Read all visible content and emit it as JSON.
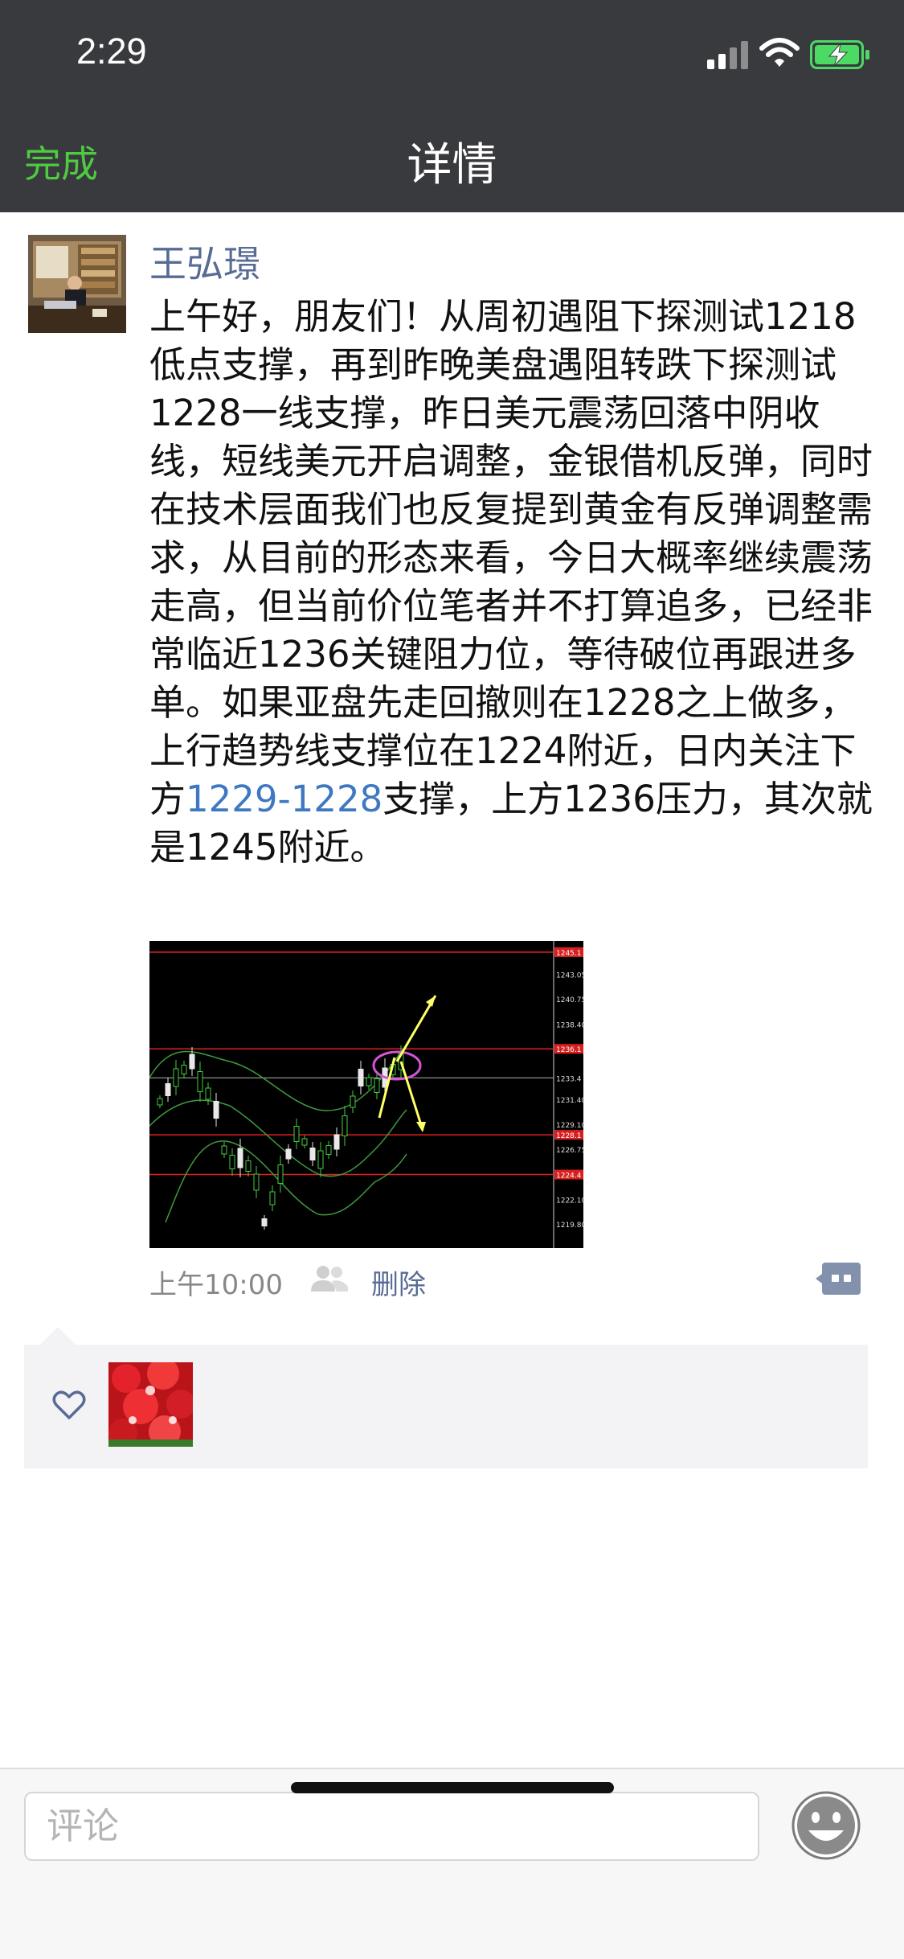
{
  "status_bar": {
    "time": "2:29",
    "icons": [
      "signal-icon",
      "wifi-icon",
      "battery-charging-icon"
    ],
    "battery_color": "#4cd964"
  },
  "nav": {
    "done_label": "完成",
    "title": "详情",
    "done_color": "#4fcb41"
  },
  "post": {
    "author": "王弘璟",
    "text_before_link": "上午好，朋友们！从周初遇阻下探测试1218低点支撑，再到昨晚美盘遇阻转跌下探测试1228一线支撑，昨日美元震荡回落中阴收线，短线美元开启调整，金银借机反弹，同时在技术层面我们也反复提到黄金有反弹调整需求，从目前的形态来看，今日大概率继续震荡走高，但当前价位笔者并不打算追多，已经非常临近1236关键阻力位，等待破位再跟进多单。如果亚盘先走回撤则在1228之上做多，上行趋势线支撑位在1224附近，日内关注下方",
    "link_text": "1229-1228",
    "text_after_link": "支撑，上方1236压力，其次就是1245附近。",
    "time": "上午10:00",
    "delete_label": "删除",
    "author_color": "#576b95",
    "link_color": "#3f78c2"
  },
  "chart_data": {
    "type": "line",
    "price_ticks": [
      "1245.1",
      "1243.05",
      "1240.75",
      "1238.40",
      "1236.1",
      "1233.4",
      "1231.40",
      "1229.10",
      "1228.1",
      "1226.75",
      "1224.4",
      "1222.10",
      "1219.80"
    ],
    "horizontal_levels": [
      1245.1,
      1236.1,
      1228.1,
      1224.4
    ],
    "highlight_color": "#d455d4",
    "arrow_color": "#ffff66"
  },
  "likes": {
    "icon": "heart-icon"
  },
  "bottom_bar": {
    "comment_placeholder": "评论",
    "emoji_icon": "emoji-icon"
  }
}
